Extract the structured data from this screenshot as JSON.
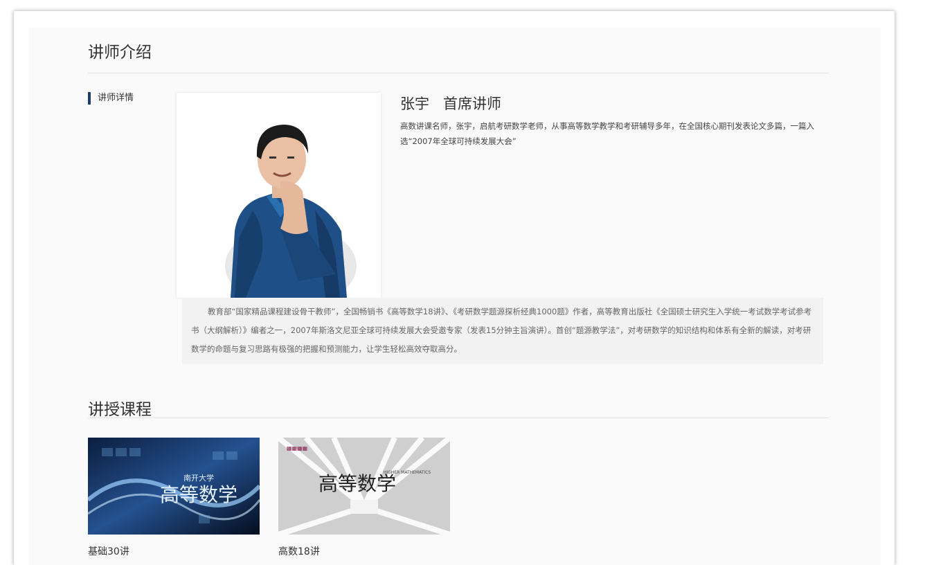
{
  "instructor_section": {
    "title": "讲师介绍",
    "tab_label": "讲师详情"
  },
  "teacher": {
    "name_title": "张宇   首席讲师",
    "summary": "高数讲课名师，张宇，启航考研数学老师，从事高等数学教学和考研辅导多年，在全国核心期刊发表论文多篇，一篇入选“2007年全球可持续发展大会”",
    "bio": "教育部“国家精品课程建设骨干教师”，全国畅销书《高等数学18讲》、《考研数学题源探析经典1000题》作者，高等教育出版社《全国硕士研究生入学统一考试数学考试参考书（大纲解析）》编者之一，2007年斯洛文尼亚全球可持续发展大会受邀专家（发表15分钟主旨演讲）。首创“题源教学法”，对考研数学的知识结构和体系有全新的解读，对考研数学的命题与复习思路有极强的把握和预测能力，让学生轻松高效夺取高分。"
  },
  "courses_section": {
    "title": "讲授课程",
    "courses": [
      {
        "label": "基础30讲",
        "thumb_text": "高等数学",
        "thumb_sub": "南开大学"
      },
      {
        "label": "高数18讲",
        "thumb_text": "高等数学",
        "thumb_sub": "HIGHER MATHEMATICS"
      }
    ]
  },
  "colors": {
    "accent": "#1f3a6d",
    "panel_bg": "#fafafa",
    "bio_bg": "#f2f2f2"
  }
}
